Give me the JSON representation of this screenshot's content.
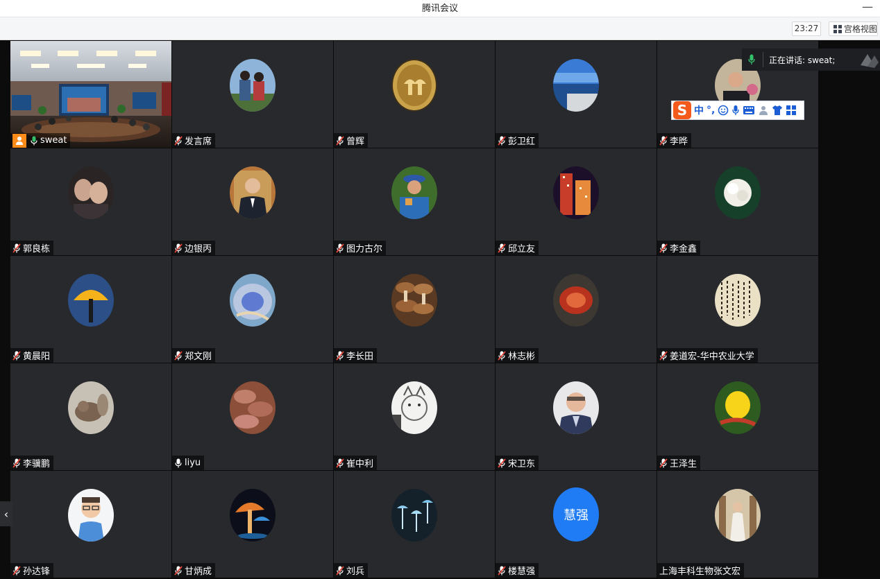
{
  "window": {
    "title": "腾讯会议"
  },
  "toolbar": {
    "timer": "23:27",
    "view_label": "宫格视图"
  },
  "speaking": {
    "text": "正在讲话: sweat;"
  },
  "ime": {
    "mode_label": "中",
    "punct_label": "°,"
  },
  "self_tile": {
    "name": "sweat"
  },
  "participants": [
    {
      "name": "发言席",
      "avatar": "kids-photo"
    },
    {
      "name": "曾辉",
      "avatar": "coin-photo"
    },
    {
      "name": "彭卫红",
      "avatar": "sea-photo"
    },
    {
      "name": "李晔",
      "avatar": "man-photo"
    },
    {
      "name": "郭良栋",
      "avatar": "couple-photo"
    },
    {
      "name": "边银丙",
      "avatar": "man-suit-photo"
    },
    {
      "name": "图力古尔",
      "avatar": "man-hat-photo"
    },
    {
      "name": "邱立友",
      "avatar": "night-city-photo"
    },
    {
      "name": "李金鑫",
      "avatar": "white-flower-photo"
    },
    {
      "name": "黄晨阳",
      "avatar": "yellow-mushroom-photo"
    },
    {
      "name": "郑文刚",
      "avatar": "pottery-photo"
    },
    {
      "name": "李长田",
      "avatar": "mushroom-cluster-photo"
    },
    {
      "name": "林志彬",
      "avatar": "red-fungus-photo"
    },
    {
      "name": "姜道宏-华中农业大学",
      "avatar": "calligraphy-photo"
    },
    {
      "name": "李骥鹏",
      "avatar": "squirrel-photo"
    },
    {
      "name": "liyu",
      "avatar": "brown-fungus-photo"
    },
    {
      "name": "崔中利",
      "avatar": "cat-sketch-photo"
    },
    {
      "name": "宋卫东",
      "avatar": "man-portrait-photo"
    },
    {
      "name": "王泽生",
      "avatar": "yellow-fruit-photo"
    },
    {
      "name": "孙达锋",
      "avatar": "cartoon-man-photo"
    },
    {
      "name": "甘炳成",
      "avatar": "glowing-mushroom-photo"
    },
    {
      "name": "刘兵",
      "avatar": "blue-mushroom-photo"
    },
    {
      "name": "楼慧强",
      "avatar": "initials",
      "initials": "慧强"
    },
    {
      "name": "上海丰科生物张文宏",
      "avatar": "woman-photo"
    }
  ],
  "colors": {
    "accent_green": "#35c06a",
    "self_badge": "#ff8c1a",
    "initials_blue": "#1f7cf5",
    "tile_bg": "#27292d"
  }
}
